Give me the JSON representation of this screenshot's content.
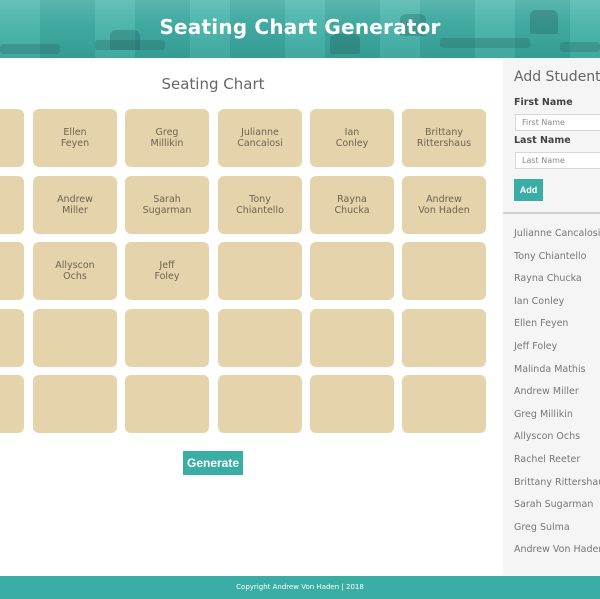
{
  "header": {
    "title": "Seating Chart Generator"
  },
  "main": {
    "title": "Seating Chart",
    "seats": [
      [
        {
          "first": "",
          "last": ""
        },
        {
          "first": "Ellen",
          "last": "Feyen"
        },
        {
          "first": "Greg",
          "last": "Millikin"
        },
        {
          "first": "Julianne",
          "last": "Cancalosi"
        },
        {
          "first": "Ian",
          "last": "Conley"
        },
        {
          "first": "Brittany",
          "last": "Rittershaus"
        }
      ],
      [
        {
          "first": "",
          "last": ""
        },
        {
          "first": "Andrew",
          "last": "Miller"
        },
        {
          "first": "Sarah",
          "last": "Sugarman"
        },
        {
          "first": "Tony",
          "last": "Chiantello"
        },
        {
          "first": "Rayna",
          "last": "Chucka"
        },
        {
          "first": "Andrew",
          "last": "Von Haden"
        }
      ],
      [
        {
          "first": "",
          "last": ""
        },
        {
          "first": "Allyscon",
          "last": "Ochs"
        },
        {
          "first": "Jeff",
          "last": "Foley"
        },
        {
          "first": "",
          "last": ""
        },
        {
          "first": "",
          "last": ""
        },
        {
          "first": "",
          "last": ""
        }
      ],
      [
        {
          "first": "",
          "last": ""
        },
        {
          "first": "",
          "last": ""
        },
        {
          "first": "",
          "last": ""
        },
        {
          "first": "",
          "last": ""
        },
        {
          "first": "",
          "last": ""
        },
        {
          "first": "",
          "last": ""
        }
      ],
      [
        {
          "first": "",
          "last": ""
        },
        {
          "first": "",
          "last": ""
        },
        {
          "first": "",
          "last": ""
        },
        {
          "first": "",
          "last": ""
        },
        {
          "first": "",
          "last": ""
        },
        {
          "first": "",
          "last": ""
        }
      ]
    ],
    "generate_label": "Generate"
  },
  "sidebar": {
    "title": "Add Student",
    "first_name_label": "First Name",
    "first_name_placeholder": "First Name",
    "first_name_value": "",
    "last_name_label": "Last Name",
    "last_name_placeholder": "Last Name",
    "last_name_value": "",
    "add_label": "Add",
    "students": [
      "Julianne Cancalosi",
      "Tony Chiantello",
      "Rayna Chucka",
      "Ian Conley",
      "Ellen Feyen",
      "Jeff Foley",
      "Malinda Mathis",
      "Andrew Miller",
      "Greg Millikin",
      "Allyscon Ochs",
      "Rachel Reeter",
      "Brittany Rittershaus",
      "Sarah Sugarman",
      "Greg Sulma",
      "Andrew Von Haden"
    ]
  },
  "footer": {
    "text": "Copyright Andrew Von Haden | 2018"
  },
  "colors": {
    "accent": "#3aaea4",
    "seat": "#e5d3ab",
    "sidebar_bg": "#f5f5f5",
    "text": "#666666"
  }
}
